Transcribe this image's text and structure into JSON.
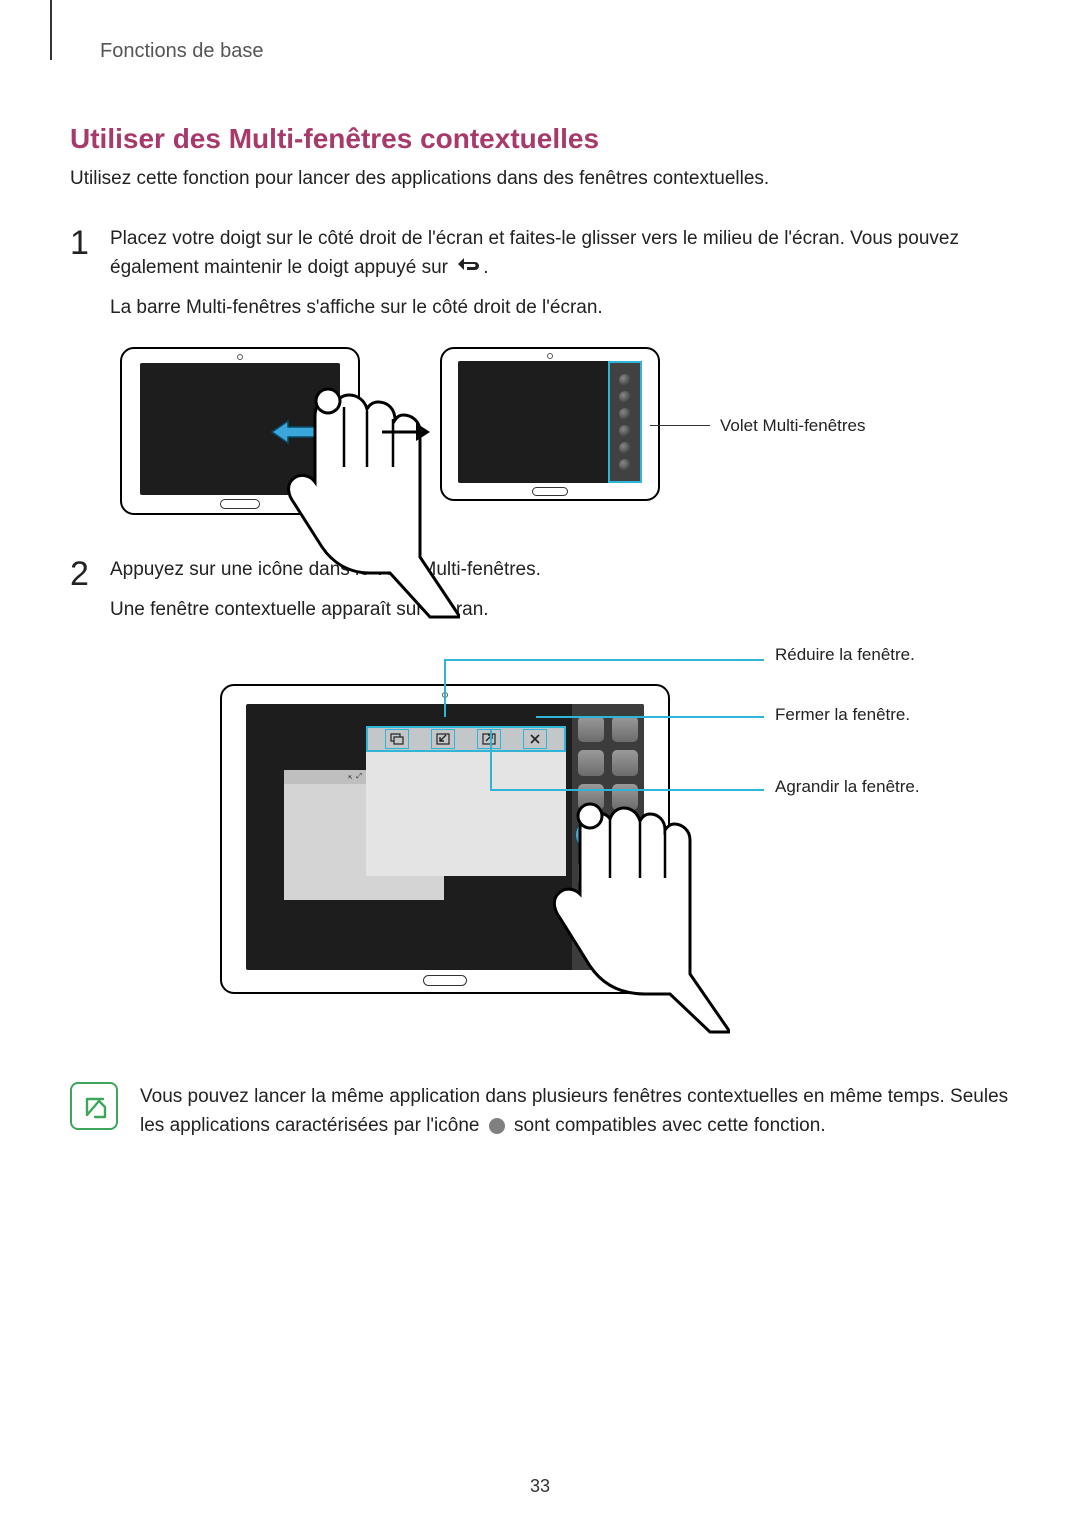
{
  "breadcrumb": "Fonctions de base",
  "heading": "Utiliser des Multi-fenêtres contextuelles",
  "intro": "Utilisez cette fonction pour lancer des applications dans des fenêtres contextuelles.",
  "steps": [
    {
      "number": "1",
      "text_part1": "Placez votre doigt sur le côté droit de l'écran et faites-le glisser vers le milieu de l'écran. Vous pouvez également maintenir le doigt appuyé sur ",
      "text_part2": ".",
      "followup": "La barre Multi-fenêtres s'affiche sur le côté droit de l'écran."
    },
    {
      "number": "2",
      "text": "Appuyez sur une icône dans le volet Multi-fenêtres.",
      "followup": "Une fenêtre contextuelle apparaît sur l'écran."
    }
  ],
  "callouts": {
    "tray_label": "Volet Multi-fenêtres",
    "minimize": "Réduire la fenêtre.",
    "close": "Fermer la fenêtre.",
    "maximize": "Agrandir la fenêtre."
  },
  "icons": {
    "back": "back-icon",
    "note": "note-icon",
    "multi_support": "multi-support-icon"
  },
  "note": {
    "text_part1": "Vous pouvez lancer la même application dans plusieurs fenêtres contextuelles en même temps. Seules les applications caractérisées par l'icône ",
    "text_part2": " sont compatibles avec cette fonction."
  },
  "page_number": "33"
}
